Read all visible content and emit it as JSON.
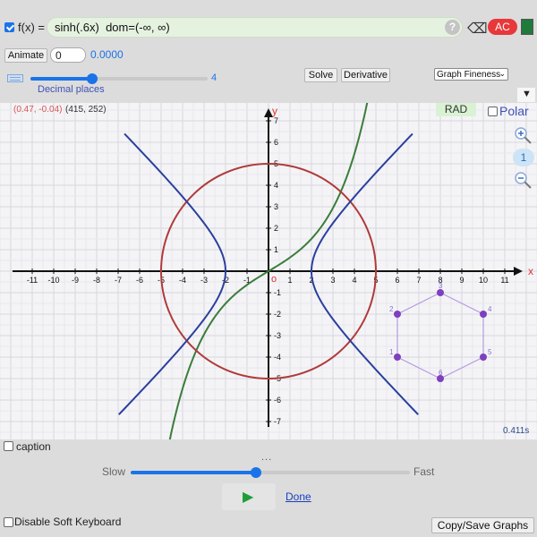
{
  "toolbar": {
    "fx_label": "f(x) =",
    "expression": "sinh(.6x)  dom=(-∞, ∞)",
    "help": "?",
    "backspace": "⌫",
    "clear": "AC"
  },
  "animate": {
    "button": "Animate",
    "input_value": "0",
    "value": "0.0000"
  },
  "decimal": {
    "label": "Decimal places",
    "value": "4",
    "fraction": 0.35
  },
  "actions": {
    "solve": "Solve",
    "derivative": "Derivative",
    "fineness": "Graph Fineness"
  },
  "plot": {
    "cursor_coords": "(0.47, -0.04)",
    "pixel_coords": "(415, 252)",
    "angle_mode": "RAD",
    "polar_label": "Polar",
    "zoom_level": "1",
    "timing": "0.411s",
    "x_axis_label": "x",
    "y_axis_label": "y",
    "origin_label": "o",
    "x_ticks": [
      "-11",
      "-10",
      "-9",
      "-8",
      "-7",
      "-6",
      "-5",
      "-4",
      "-3",
      "-2",
      "-1",
      "1",
      "2",
      "3",
      "4",
      "5",
      "6",
      "7",
      "8",
      "9",
      "10",
      "11"
    ],
    "y_ticks": [
      "7",
      "6",
      "5",
      "4",
      "3",
      "2",
      "1",
      "-1",
      "-2",
      "-3",
      "-4",
      "-5",
      "-6",
      "-7"
    ],
    "hexagon_labels": [
      "1",
      "2",
      "3",
      "4",
      "5",
      "6"
    ]
  },
  "chart_data": {
    "type": "line",
    "xlim": [
      -12,
      12
    ],
    "ylim": [
      -7.4,
      7.5
    ],
    "grid": true,
    "series": [
      {
        "kind": "function",
        "expr": "sinh(0.6x)",
        "color": "#3a7d3a"
      },
      {
        "kind": "circle",
        "center": [
          0,
          0
        ],
        "radius": 5,
        "color": "#b03a3a"
      },
      {
        "kind": "hyperbola",
        "equation": "x^2/4 - y^2/4 = 1",
        "color": "#2b3f9e"
      },
      {
        "kind": "polygon",
        "points": [
          [
            6,
            -4
          ],
          [
            6,
            -2
          ],
          [
            8,
            -1
          ],
          [
            10,
            -2
          ],
          [
            10,
            -4
          ],
          [
            8,
            -5
          ]
        ],
        "color": "#7e3fc0"
      }
    ]
  },
  "bottom": {
    "caption_label": "caption",
    "dots": "...",
    "slow": "Slow",
    "fast": "Fast",
    "speed_fraction": 0.45,
    "done": "Done",
    "disable_keyboard": "Disable Soft Keyboard",
    "copy_save": "Copy/Save Graphs"
  },
  "colors": {
    "accent": "#1a73e8",
    "clear_button": "#e8383a",
    "expression_bg": "#e6f2e0",
    "swatch": "#1f7a3b"
  }
}
